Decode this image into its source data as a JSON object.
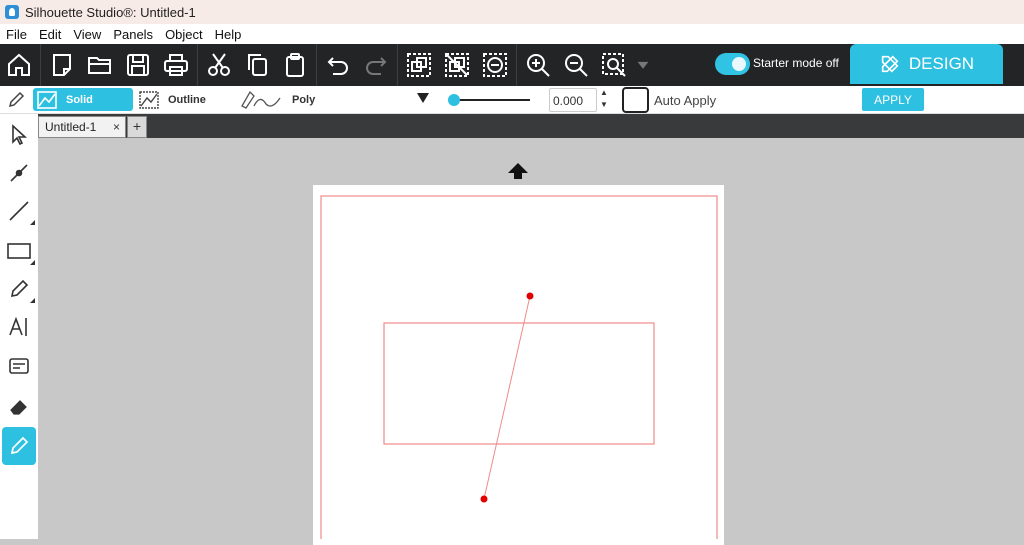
{
  "window": {
    "title": "Silhouette Studio®: Untitled-1"
  },
  "menu": [
    "File",
    "Edit",
    "View",
    "Panels",
    "Object",
    "Help"
  ],
  "toolbar": {
    "icons": [
      "home-icon",
      "new-document-icon",
      "open-folder-icon",
      "save-icon",
      "print-icon",
      "cut-icon",
      "copy-icon",
      "paste-icon",
      "undo-icon",
      "redo-icon",
      "group-icon",
      "ungroup-icon",
      "weld-icon",
      "zoom-in-icon",
      "zoom-out-icon",
      "zoom-fit-icon"
    ],
    "starter_mode_label": "Starter mode off",
    "starter_mode_on": true,
    "design_tab_label": "DESIGN"
  },
  "subtoolbar": {
    "solid_label": "Solid",
    "outline_label": "Outline",
    "poly_label": "Poly",
    "value": "0.000",
    "auto_apply_label": "Auto Apply",
    "apply_label": "APPLY"
  },
  "tabs": {
    "document_tab_label": "Untitled-1",
    "close_glyph": "×",
    "new_tab_glyph": "+"
  },
  "left_tools": [
    "select-tool",
    "point-edit-tool",
    "line-tool",
    "shape-tool",
    "draw-tool",
    "text-tool",
    "text-style-tool",
    "eraser-tool",
    "knife-tool"
  ],
  "colors": {
    "accent": "#2dc0e0",
    "toolbar_bg": "#222426",
    "cut_line": "#f08a8a",
    "point": "#e00000"
  }
}
